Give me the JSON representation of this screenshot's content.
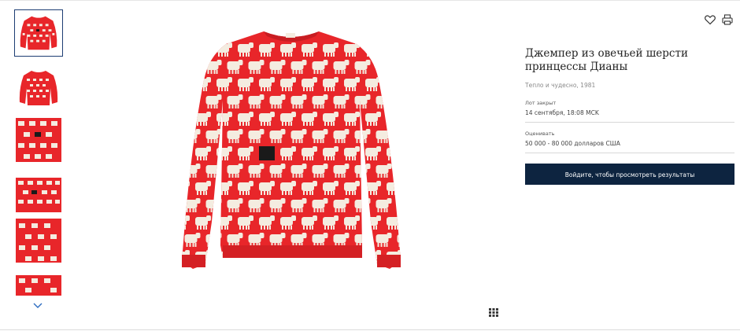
{
  "lot": {
    "title": "Джемпер из овечьей шерсти принцессы Дианы",
    "subtitle": "Тепло и чудесно, 1981",
    "closed_label": "Лот закрыт",
    "closed_value": "14 сентября, 18:08 MCK",
    "estimate_label": "Оценивать",
    "estimate_value": "50 000 - 80 000 долларов США",
    "cta_label": "Войдите, чтобы просмотреть результаты"
  },
  "icons": {
    "favorite": "heart-icon",
    "print": "printer-icon",
    "gallery": "grid-icon",
    "thumbs_next": "chevron-down-icon"
  },
  "colors": {
    "sweater_red": "#e8262a",
    "sheep_cream": "#f4ece0",
    "black_sheep": "#1a1a1a",
    "button_navy": "#0d2440",
    "active_thumb_border": "#1d3d73",
    "chevron_blue": "#2d6cc0"
  }
}
